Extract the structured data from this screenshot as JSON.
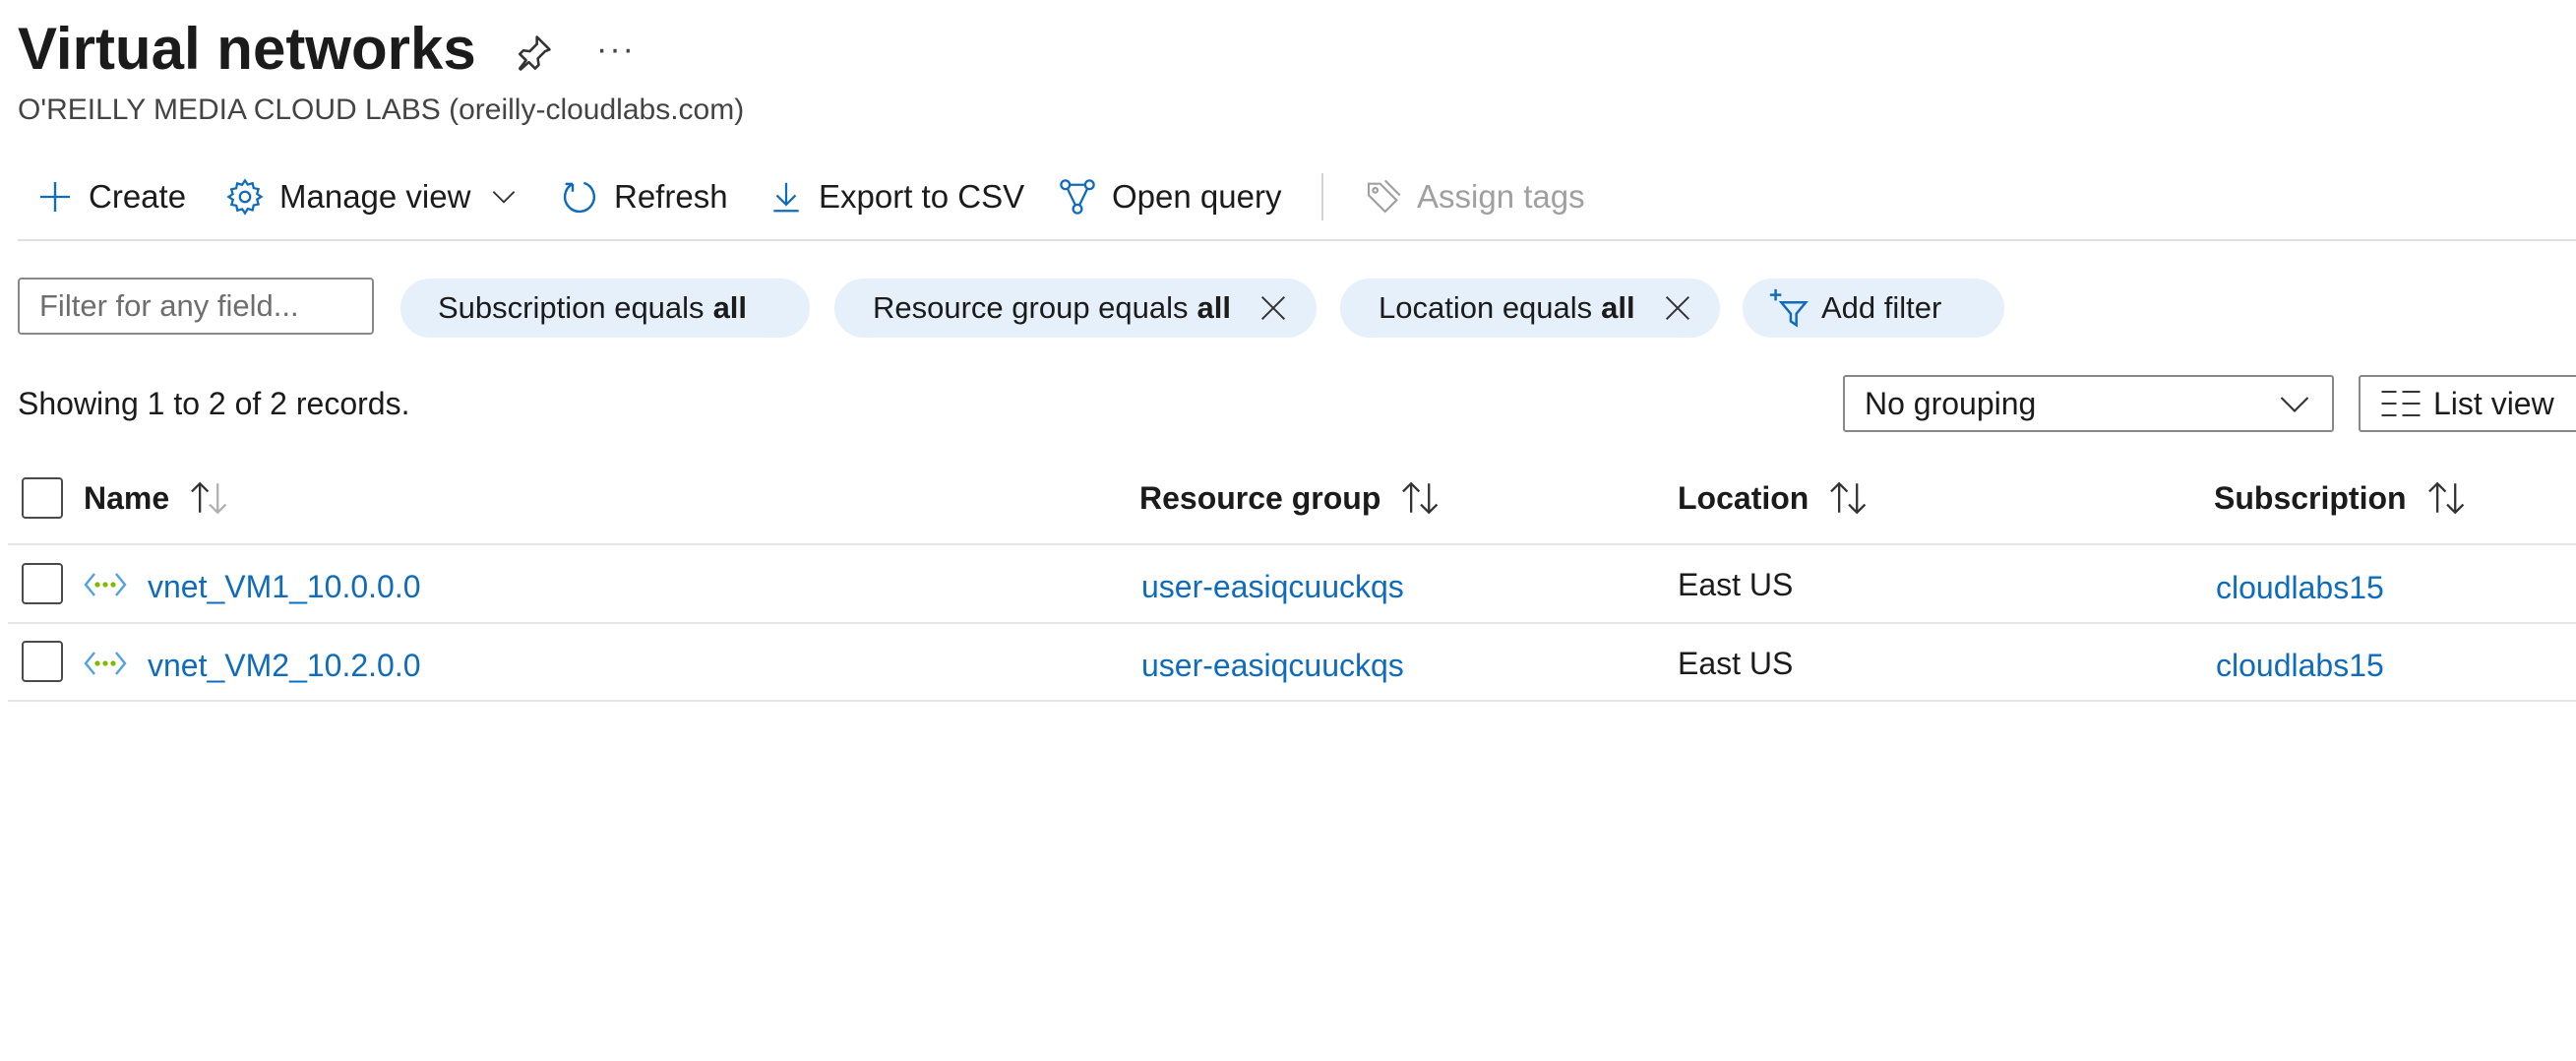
{
  "page": {
    "title": "Virtual networks",
    "subtitle": "O'REILLY MEDIA CLOUD LABS (oreilly-cloudlabs.com)",
    "more_label": "···"
  },
  "toolbar": {
    "create": "Create",
    "manage_view": "Manage view",
    "refresh": "Refresh",
    "export_csv": "Export to CSV",
    "open_query": "Open query",
    "assign_tags": "Assign tags"
  },
  "filters": {
    "search_placeholder": "Filter for any field...",
    "pills": [
      {
        "label": "Subscription equals",
        "value": "all",
        "removable": false
      },
      {
        "label": "Resource group equals",
        "value": "all",
        "removable": true
      },
      {
        "label": "Location equals",
        "value": "all",
        "removable": true
      }
    ],
    "add_filter": "Add filter"
  },
  "records_text": "Showing 1 to 2 of 2 records.",
  "grouping": {
    "selected": "No grouping"
  },
  "view_toggle": "List view",
  "table": {
    "columns": [
      "Name",
      "Resource group",
      "Location",
      "Subscription"
    ],
    "rows": [
      {
        "name": "vnet_VM1_10.0.0.0",
        "resource_group": "user-easiqcuuckqs",
        "location": "East US",
        "subscription": "cloudlabs15"
      },
      {
        "name": "vnet_VM2_10.2.0.0",
        "resource_group": "user-easiqcuuckqs",
        "location": "East US",
        "subscription": "cloudlabs15"
      }
    ]
  },
  "colors": {
    "accent": "#0f6cbd",
    "pill_bg": "#e6f0fa",
    "disabled": "#a0a0a0",
    "vnet_icon_blue": "#50a0e6",
    "vnet_icon_green": "#7fba00"
  }
}
